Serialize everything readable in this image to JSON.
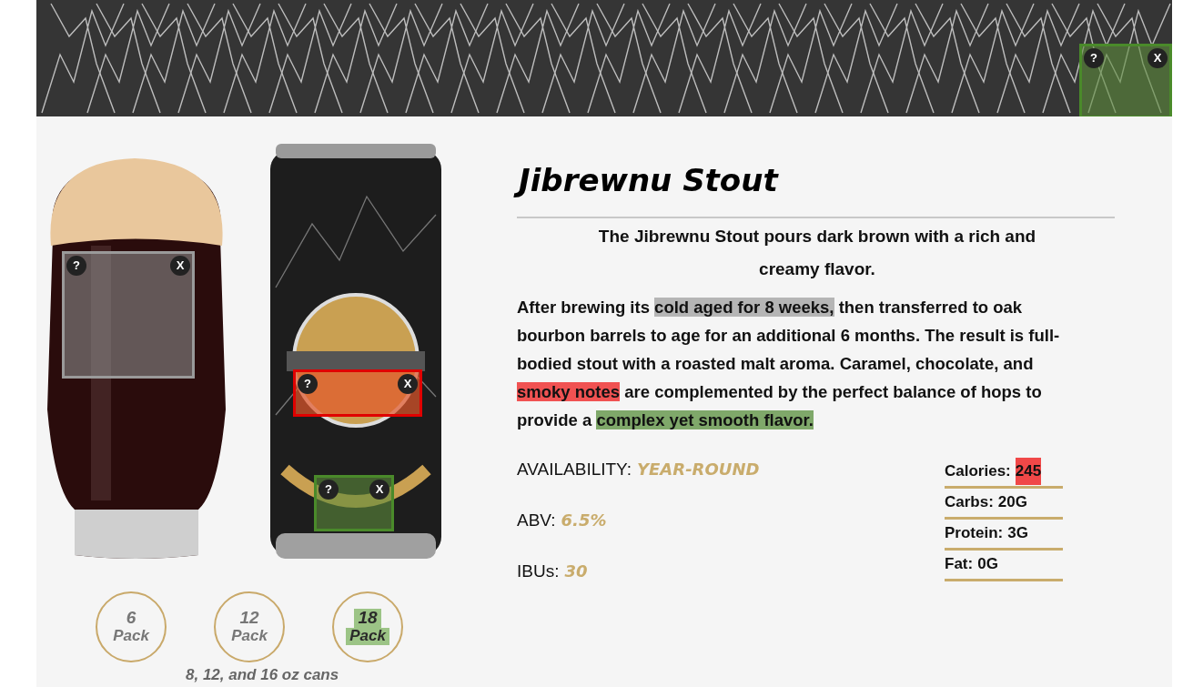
{
  "header": {
    "overlay": {
      "kind": "green",
      "help": "?",
      "close": "X"
    }
  },
  "glass": {
    "overlay": {
      "kind": "gray",
      "help": "?",
      "close": "X"
    }
  },
  "can": {
    "overlays": [
      {
        "kind": "red",
        "help": "?",
        "close": "X"
      },
      {
        "kind": "green",
        "help": "?",
        "close": "X"
      }
    ]
  },
  "packs": [
    {
      "number": "6",
      "label": "Pack",
      "highlighted": false
    },
    {
      "number": "12",
      "label": "Pack",
      "highlighted": false
    },
    {
      "number": "18",
      "label": "Pack",
      "highlighted": true
    }
  ],
  "packs_caption": "8, 12, and 16 oz cans",
  "title": "Jibrewnu Stout",
  "subtitle": "The Jibrewnu Stout pours dark brown with a rich and creamy flavor.",
  "description": [
    {
      "text": "After brewing its "
    },
    {
      "text": "cold aged for 8 weeks,",
      "color": "#b5b5b5"
    },
    {
      "text": " then transferred to oak bourbon barrels to age for an additional **6** months. The result is full-bodied stout with a roasted malt aroma. Caramel, chocolate, and "
    },
    {
      "text": "smoky notes",
      "color": "#f05252"
    },
    {
      "text": " are complemented by the perfect balance of hops to provide a "
    },
    {
      "text": "complex yet smooth flavor.",
      "color": "#7fa86a"
    }
  ],
  "stats": [
    {
      "label": "AVAILABILITY:",
      "value": "YEAR-ROUND"
    },
    {
      "label": "ABV:",
      "value": "6.5%"
    },
    {
      "label": "IBUs:",
      "value": "30"
    }
  ],
  "nutrition": [
    {
      "label": "Calories:",
      "value": "245",
      "color": "#f04848"
    },
    {
      "label": "Carbs:",
      "value": "20G"
    },
    {
      "label": "Protein:",
      "value": "3G"
    },
    {
      "label": "Fat:",
      "value": "0G"
    }
  ]
}
